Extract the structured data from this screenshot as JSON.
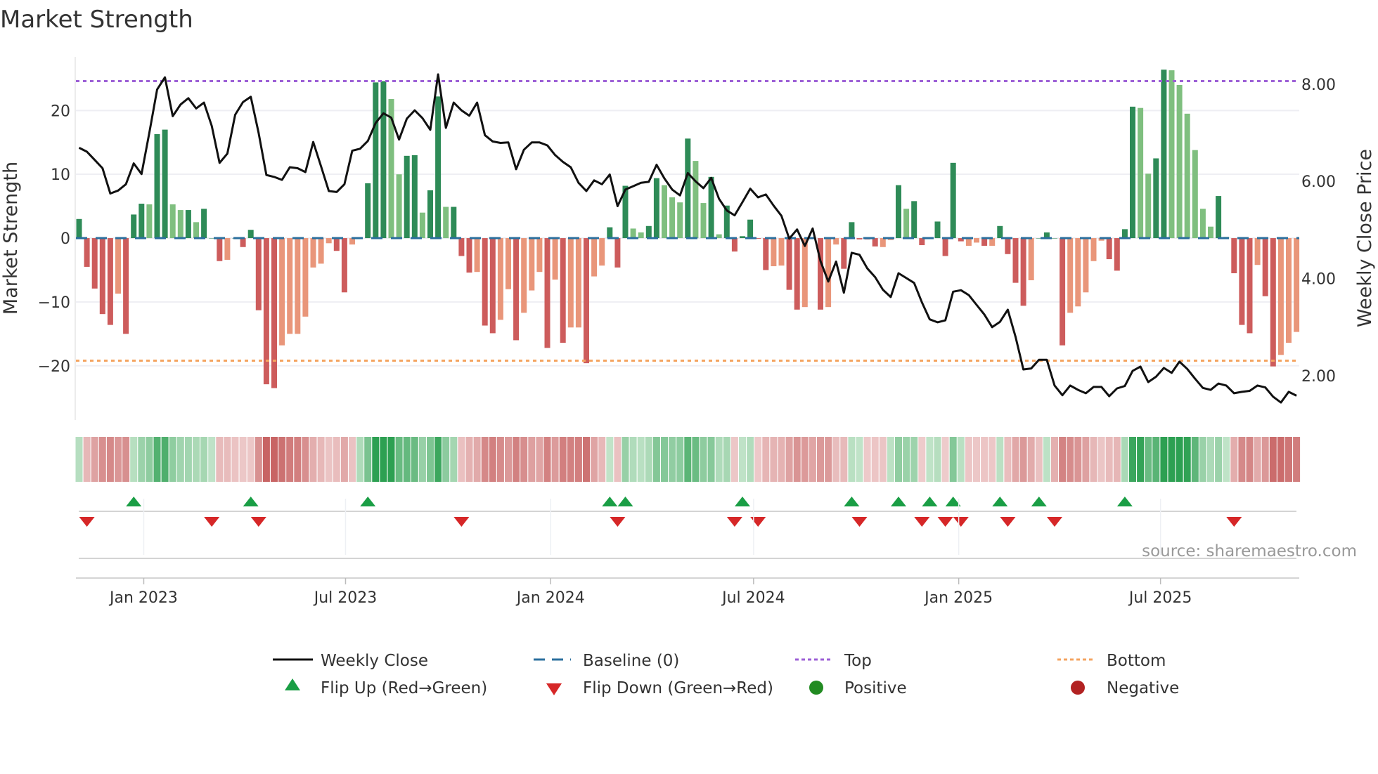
{
  "chart_data": {
    "type": "bar",
    "title": "Market Strength",
    "ylabel": "Market Strength",
    "y2label": "Weekly Close Price",
    "source": "source: sharemaestro.com",
    "start_date": "2022-11-04",
    "frequency": "weekly",
    "ylim": [
      -28.5,
      28.4
    ],
    "y2lim": [
      1.09,
      8.56
    ],
    "y_ticks": [
      {
        "v": -20,
        "label": "−20"
      },
      {
        "v": -10,
        "label": "−10"
      },
      {
        "v": 0,
        "label": "0"
      },
      {
        "v": 10,
        "label": "10"
      },
      {
        "v": 20,
        "label": "20"
      }
    ],
    "y2_ticks": [
      {
        "v": 2,
        "label": "2.00"
      },
      {
        "v": 4,
        "label": "4.00"
      },
      {
        "v": 6,
        "label": "6.00"
      },
      {
        "v": 8,
        "label": "8.00"
      }
    ],
    "x_ticks": [
      {
        "date": "2023-01-01",
        "label": "Jan 2023"
      },
      {
        "date": "2023-07-01",
        "label": "Jul 2023"
      },
      {
        "date": "2024-01-01",
        "label": "Jan 2024"
      },
      {
        "date": "2024-07-01",
        "label": "Jul 2024"
      },
      {
        "date": "2025-01-01",
        "label": "Jan 2025"
      },
      {
        "date": "2025-07-01",
        "label": "Jul 2025"
      }
    ],
    "top_level": 24.6,
    "bottom_level": -19.2,
    "strength": [
      3,
      -4.5,
      -7.9,
      -11.9,
      -13.6,
      -8.7,
      -15,
      3.7,
      5.4,
      5.3,
      16.3,
      17,
      5.3,
      4.4,
      4.4,
      2.5,
      4.6,
      0,
      -3.6,
      -3.4,
      0,
      -1.4,
      1.3,
      -11.3,
      -22.9,
      -23.5,
      -16.8,
      -15,
      -15,
      -12.3,
      -4.6,
      -4,
      -0.8,
      -2,
      -8.5,
      -1,
      0,
      8.6,
      24.4,
      24.6,
      21.8,
      10,
      12.9,
      13,
      4,
      7.5,
      22.2,
      4.9,
      4.9,
      -2.8,
      -5.4,
      -5.3,
      -13.7,
      -14.9,
      -12.8,
      -8,
      -16,
      -11.7,
      -8.2,
      -5.3,
      -17.2,
      -6.5,
      -16.4,
      -14,
      -14,
      -19.6,
      -6,
      -4.3,
      1.7,
      -4.6,
      8.2,
      1.5,
      0.9,
      1.9,
      9.4,
      8.3,
      6.4,
      5.6,
      15.6,
      12.1,
      5.5,
      9.6,
      0.6,
      5.1,
      -2.1,
      0.3,
      2.9,
      -0.1,
      -5,
      -4.4,
      -4.3,
      -8.1,
      -11.2,
      -10.8,
      0,
      -11.2,
      -10.8,
      -1,
      -4.8,
      2.5,
      -0.2,
      -0.2,
      -1.3,
      -1.4,
      -0.3,
      8.3,
      4.6,
      5.8,
      -1.1,
      0.1,
      2.6,
      -2.8,
      11.8,
      -0.5,
      -1.2,
      -0.7,
      -1.2,
      -1.2,
      1.9,
      -2.5,
      -7,
      -10.6,
      -6.6,
      0,
      0.9,
      0,
      -16.8,
      -11.7,
      -10.7,
      -8.5,
      -3.6,
      -0.4,
      -3.3,
      -5.1,
      1.4,
      20.6,
      20.4,
      10.1,
      12.5,
      26.4,
      26.3,
      24,
      19.5,
      13.8,
      4.6,
      1.8,
      6.6,
      0.2,
      -5.5,
      -13.6,
      -14.9,
      -4.2,
      -9.1,
      -20.1,
      -18.3,
      -16.4,
      -14.7
    ],
    "strong": [
      1,
      1,
      1,
      1,
      1,
      0,
      1,
      1,
      1,
      0,
      1,
      1,
      0,
      0,
      1,
      0,
      1,
      1,
      1,
      0,
      1,
      1,
      1,
      1,
      1,
      1,
      0,
      0,
      0,
      0,
      0,
      0,
      0,
      1,
      1,
      0,
      1,
      1,
      1,
      1,
      0,
      0,
      1,
      1,
      0,
      1,
      1,
      0,
      1,
      1,
      1,
      0,
      1,
      1,
      0,
      0,
      1,
      0,
      0,
      0,
      1,
      0,
      1,
      0,
      0,
      1,
      0,
      0,
      1,
      1,
      1,
      0,
      0,
      1,
      1,
      0,
      0,
      0,
      1,
      0,
      0,
      1,
      0,
      1,
      1,
      1,
      1,
      1,
      1,
      0,
      0,
      1,
      1,
      0,
      1,
      1,
      0,
      0,
      1,
      1,
      1,
      1,
      1,
      0,
      0,
      1,
      0,
      1,
      1,
      0,
      1,
      1,
      1,
      1,
      0,
      0,
      1,
      0,
      1,
      1,
      1,
      1,
      0,
      1,
      1,
      1,
      1,
      0,
      0,
      0,
      0,
      0,
      1,
      1,
      1,
      1,
      0,
      0,
      1,
      1,
      0,
      0,
      0,
      0,
      0,
      0,
      1,
      0,
      1,
      1,
      1,
      0,
      1,
      1,
      0,
      0,
      0
    ],
    "close": [
      6.69,
      6.61,
      6.44,
      6.27,
      5.75,
      5.81,
      5.94,
      6.37,
      6.15,
      7.0,
      7.89,
      8.14,
      7.34,
      7.58,
      7.71,
      7.5,
      7.62,
      7.14,
      6.38,
      6.57,
      7.37,
      7.63,
      7.74,
      7.0,
      6.13,
      6.09,
      6.03,
      6.29,
      6.27,
      6.19,
      6.81,
      6.31,
      5.8,
      5.78,
      5.94,
      6.63,
      6.67,
      6.83,
      7.2,
      7.4,
      7.31,
      6.86,
      7.29,
      7.46,
      7.3,
      7.06,
      8.2,
      7.1,
      7.62,
      7.46,
      7.35,
      7.62,
      6.95,
      6.82,
      6.79,
      6.8,
      6.25,
      6.65,
      6.8,
      6.8,
      6.74,
      6.54,
      6.4,
      6.29,
      5.97,
      5.8,
      6.02,
      5.94,
      6.14,
      5.49,
      5.83,
      5.9,
      5.97,
      5.99,
      6.34,
      6.06,
      5.83,
      5.71,
      6.17,
      6.0,
      5.86,
      6.07,
      5.64,
      5.4,
      5.3,
      5.57,
      5.85,
      5.67,
      5.73,
      5.5,
      5.29,
      4.82,
      5.01,
      4.67,
      5.03,
      4.36,
      3.94,
      4.35,
      3.71,
      4.53,
      4.49,
      4.21,
      4.03,
      3.77,
      3.62,
      4.11,
      4.01,
      3.91,
      3.51,
      3.16,
      3.1,
      3.14,
      3.73,
      3.76,
      3.66,
      3.46,
      3.26,
      3.0,
      3.11,
      3.36,
      2.8,
      2.13,
      2.15,
      2.33,
      2.33,
      1.8,
      1.6,
      1.8,
      1.71,
      1.64,
      1.77,
      1.77,
      1.58,
      1.74,
      1.79,
      2.1,
      2.19,
      1.87,
      1.98,
      2.16,
      2.06,
      2.29,
      2.14,
      1.94,
      1.75,
      1.71,
      1.84,
      1.8,
      1.64,
      1.67,
      1.69,
      1.8,
      1.76,
      1.57,
      1.45,
      1.67,
      1.59
    ],
    "flip_up_weeks": [
      7,
      22,
      37,
      68,
      70,
      85,
      99,
      105,
      109,
      112,
      118,
      123,
      134
    ],
    "flip_down_weeks": [
      1,
      17,
      23,
      49,
      69,
      84,
      87,
      100,
      108,
      111,
      113,
      119,
      125,
      148
    ],
    "legend": {
      "weekly_close": "Weekly Close",
      "baseline": "Baseline (0)",
      "top": "Top",
      "bottom": "Bottom",
      "flip_up": "Flip Up (Red→Green)",
      "flip_down": "Flip Down (Green→Red)",
      "positive": "Positive",
      "negative": "Negative"
    },
    "colors": {
      "pos_strong": "#2e8b57",
      "pos_weak": "#7fbf7f",
      "neg_strong": "#cd5c5c",
      "neg_weak": "#e9967a",
      "close": "#111111",
      "baseline": "#2b6f9e",
      "top": "#9c5fd6",
      "bottom": "#f4a460",
      "flip_up": "#1a9e45",
      "flip_down": "#d62728",
      "positive": "#228b22",
      "negative": "#b22222"
    }
  }
}
